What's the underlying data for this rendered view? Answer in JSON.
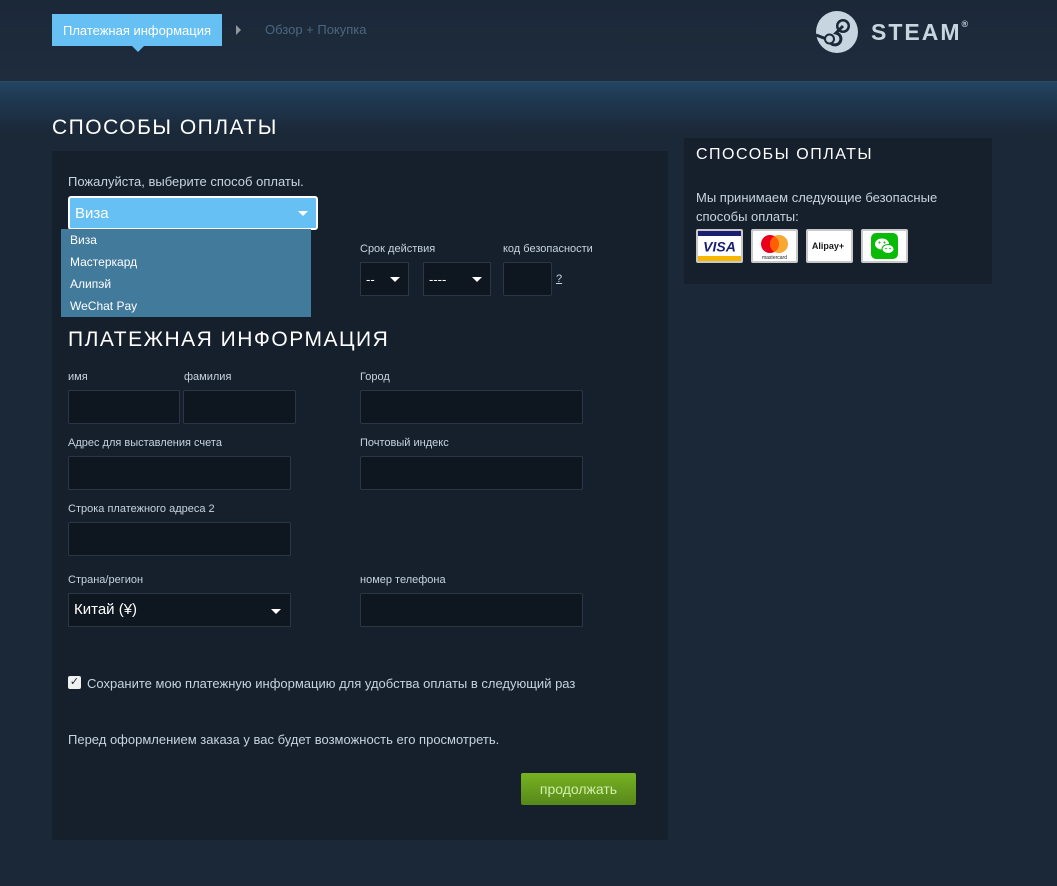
{
  "header": {
    "step_active": "Платежная информация",
    "step_next": "Обзор + Покупка",
    "logo_text": "STEAM"
  },
  "main": {
    "title": "СПОСОБЫ ОПЛАТЫ",
    "choose_label": "Пожалуйста, выберите способ оплаты.",
    "payment_method": {
      "selected": "Виза",
      "options": [
        "Виза",
        "Мастеркард",
        "Алипэй",
        "WeChat Pay"
      ]
    },
    "expiration_label": "Срок действия",
    "expiration_month": "--",
    "expiration_year": "----",
    "security_code_label": "код безопасности",
    "security_help": "?",
    "billing_title": "ПЛАТЕЖНАЯ ИНФОРМАЦИЯ",
    "first_name_label": "имя",
    "last_name_label": "фамилия",
    "city_label": "Город",
    "address_label": "Адрес для выставления счета",
    "zip_label": "Почтовый индекс",
    "address2_label": "Строка платежного адреса 2",
    "country_label": "Страна/регион",
    "country_value": "Китай (¥)",
    "phone_label": "номер телефона",
    "save_info_label": "Сохраните мою платежную информацию для удобства оплаты в следующий раз",
    "save_info_checked": true,
    "review_note": "Перед оформлением заказа у вас будет возможность его просмотреть.",
    "continue_label": "продолжать"
  },
  "sidebar": {
    "title": "СПОСОБЫ ОПЛАТЫ",
    "text": "Мы принимаем следующие безопасные способы оплаты:",
    "cards": [
      "VISA",
      "mastercard",
      "Alipay+",
      "WeChat"
    ]
  },
  "colors": {
    "background": "#1b2838",
    "panel": "#16202d",
    "accent": "#66c0f4",
    "dropdown": "#417a9b",
    "button_green": "#75b022"
  }
}
